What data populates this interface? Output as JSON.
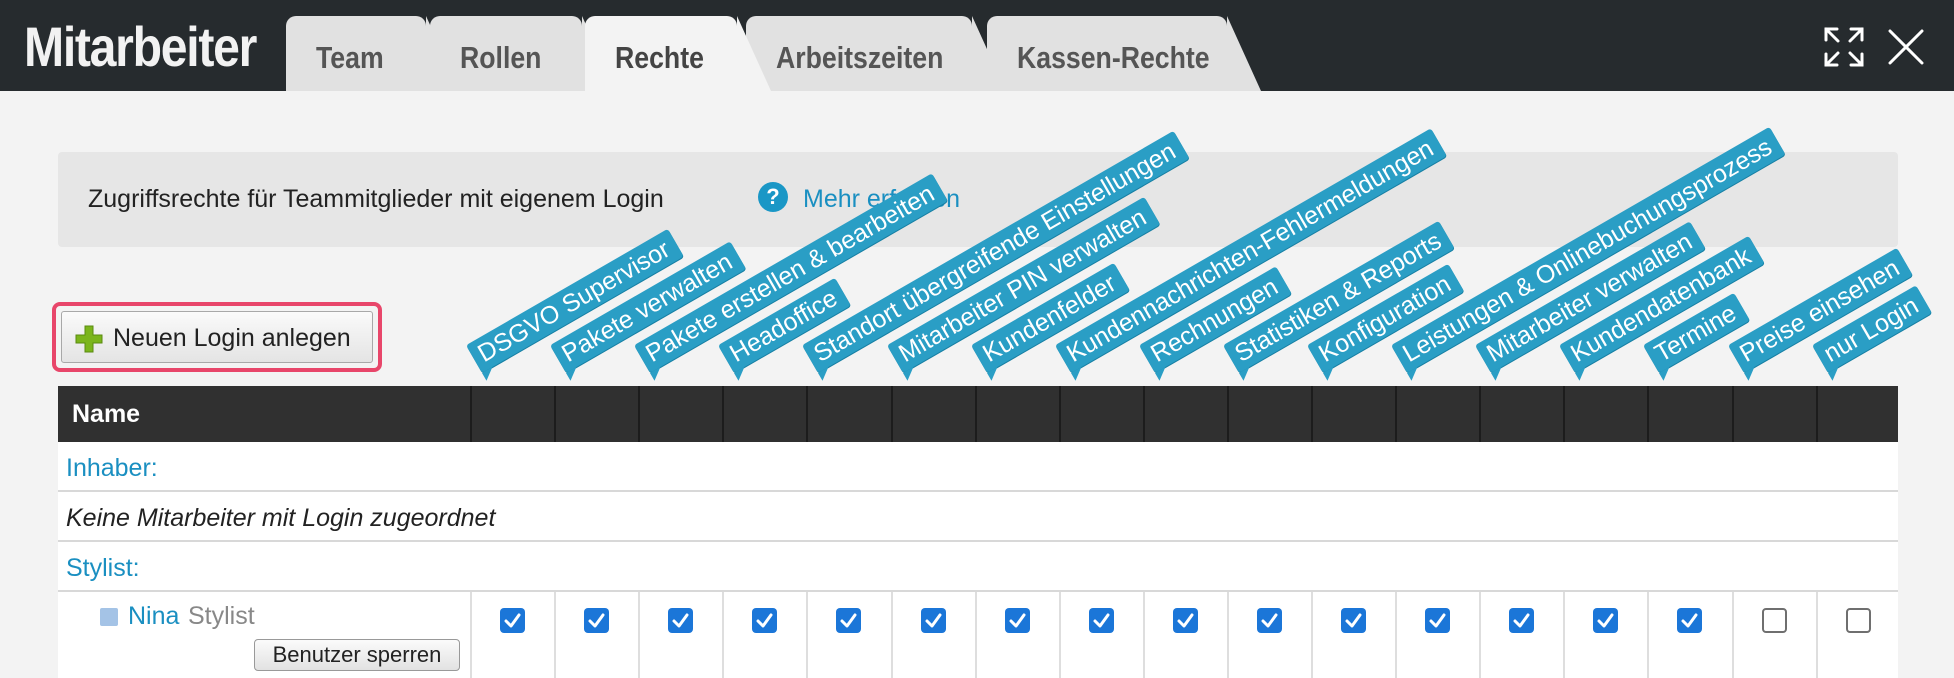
{
  "app": {
    "title": "Mitarbeiter"
  },
  "tabs": [
    {
      "label": "Team",
      "active": false
    },
    {
      "label": "Rollen",
      "active": false
    },
    {
      "label": "Rechte",
      "active": true
    },
    {
      "label": "Arbeitszeiten",
      "active": false
    },
    {
      "label": "Kassen-Rechte",
      "active": false
    }
  ],
  "window_controls": {
    "expand_icon": "expand-icon",
    "close_icon": "close-icon"
  },
  "info": {
    "text": "Zugriffsrechte für Teammitglieder mit eigenem Login",
    "help_icon": "question-icon",
    "link": "Mehr erfahren"
  },
  "toolbar": {
    "new_login_label": "Neuen Login anlegen",
    "new_login_icon": "plus-icon"
  },
  "table": {
    "name_header": "Name",
    "columns": [
      "DSGVO Supervisor",
      "Pakete verwalten",
      "Pakete erstellen & bearbeiten",
      "Headoffice",
      "Standort übergreifende Einstellungen",
      "Mitarbeiter PIN verwalten",
      "Kundenfelder",
      "Kundennachrichten-Fehlermeldungen",
      "Rechnungen",
      "Statistiken & Reports",
      "Konfiguration",
      "Leistungen & Onlinebuchungsprozess",
      "Mitarbeiter verwalten",
      "Kundendatenbank",
      "Termine",
      "Preise einsehen",
      "nur Login"
    ],
    "groups": [
      {
        "label": "Inhaber:",
        "empty_text": "Keine Mitarbeiter mit Login zugeordnet"
      },
      {
        "label": "Stylist:"
      }
    ],
    "employee": {
      "name": "Nina",
      "role": "Stylist",
      "lock_button": "Benutzer sperren",
      "permissions": [
        true,
        true,
        true,
        true,
        true,
        true,
        true,
        true,
        true,
        true,
        true,
        true,
        true,
        true,
        true,
        false,
        false
      ]
    }
  },
  "colors": {
    "accent": "#2a9ec5",
    "link": "#1a8fc1",
    "header_bg": "#262b2e",
    "highlight": "#e8466a",
    "checkbox": "#1b76d8"
  }
}
